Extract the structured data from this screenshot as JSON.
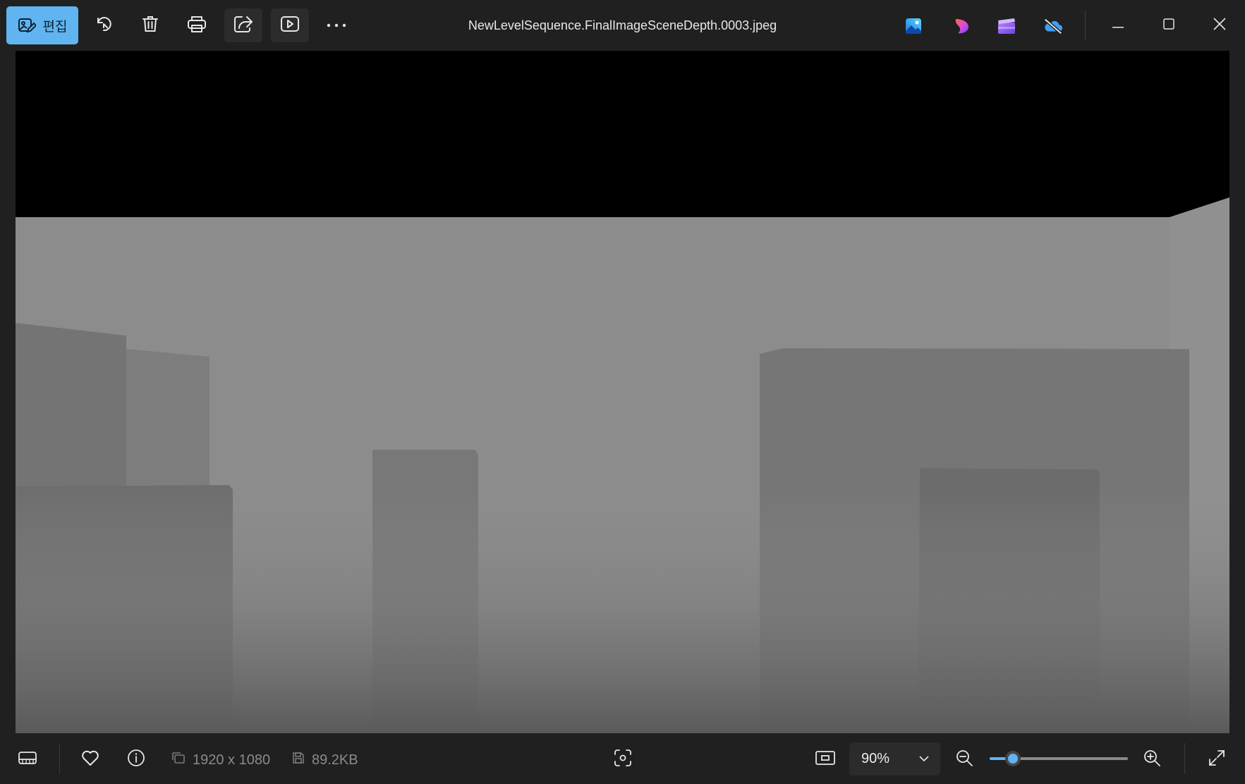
{
  "toolbar": {
    "edit_label": "편집",
    "buttons": [
      {
        "name": "rotate",
        "icon": "rotate-icon"
      },
      {
        "name": "delete",
        "icon": "trash-icon"
      },
      {
        "name": "print",
        "icon": "printer-icon"
      },
      {
        "name": "share",
        "icon": "share-icon"
      },
      {
        "name": "slideshow",
        "icon": "play-icon"
      },
      {
        "name": "more",
        "icon": "more-icon",
        "label": "···"
      }
    ]
  },
  "window": {
    "title": "NewLevelSequence.FinalImageSceneDepth.0003.jpeg",
    "app_icons": [
      "photos-app-icon",
      "copilot-icon",
      "clipchamp-icon",
      "onedrive-off-icon"
    ],
    "controls": [
      "minimize-icon",
      "maximize-icon",
      "close-icon"
    ]
  },
  "image": {
    "description_colors": {
      "sky": "#000000",
      "far_wall": "#8c8c8c",
      "mid_box": "#787878",
      "near_box": "#6e6e6e",
      "floor_near": "#595959"
    }
  },
  "statusbar": {
    "dimensions": "1920 x 1080",
    "file_size": "89.2KB",
    "zoom_value": "90%",
    "zoom_fraction": 0.17
  },
  "colors": {
    "accent": "#60b4f0",
    "background": "#202020",
    "text": "#e6e6e6",
    "muted_text": "#8a8a8a"
  }
}
